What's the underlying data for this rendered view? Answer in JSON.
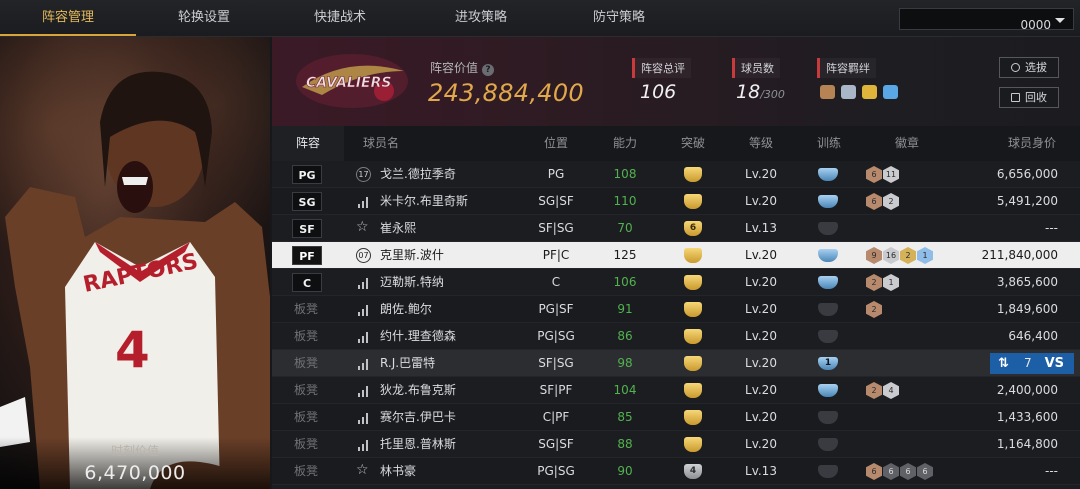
{
  "tabs": [
    "阵容管理",
    "轮换设置",
    "快捷战术",
    "进攻策略",
    "防守策略"
  ],
  "team_select": {
    "value": "0000"
  },
  "portrait": {
    "value_label": "时刻价值",
    "value": "6,470,000"
  },
  "header": {
    "team_logo_text": "CAVALIERS",
    "value_label": "阵容价值",
    "value": "243,884,400",
    "total_rating_label": "阵容总评",
    "total_rating": "106",
    "player_count_label": "球员数",
    "player_count": "18",
    "player_count_max": "/300",
    "bond_label": "阵容羁绊",
    "pick_button": "选拔",
    "recycle_button": "回收"
  },
  "columns": [
    "阵容",
    "球员名",
    "位置",
    "能力",
    "突破",
    "等级",
    "训练",
    "徽章",
    "球员身价"
  ],
  "rows": [
    {
      "lineup": "PG",
      "starter": true,
      "icon": "num",
      "icon_text": "17",
      "name": "戈兰.德拉季奇",
      "position": "PG",
      "ability": "108",
      "ability_color": "green",
      "break": "",
      "break_color": "gold",
      "level": "Lv.20",
      "train": "",
      "train_color": "blue",
      "badges": [
        {
          "t": "6",
          "c": "bz"
        },
        {
          "t": "11",
          "c": "sv"
        }
      ],
      "value": "6,656,000"
    },
    {
      "lineup": "SG",
      "starter": true,
      "icon": "bars",
      "icon_text": "",
      "name": "米卡尔.布里奇斯",
      "position": "SG|SF",
      "ability": "110",
      "ability_color": "green",
      "break": "",
      "break_color": "gold",
      "level": "Lv.20",
      "train": "",
      "train_color": "blue",
      "badges": [
        {
          "t": "6",
          "c": "bz"
        },
        {
          "t": "2",
          "c": "sv"
        }
      ],
      "value": "5,491,200"
    },
    {
      "lineup": "SF",
      "starter": true,
      "icon": "star",
      "icon_text": "",
      "name": "崔永熙",
      "position": "SF|SG",
      "ability": "70",
      "ability_color": "green",
      "break": "6",
      "break_color": "gold",
      "level": "Lv.13",
      "train": "",
      "train_color": "dark",
      "badges": [],
      "value": "---"
    },
    {
      "lineup": "PF",
      "starter": true,
      "icon": "num",
      "icon_text": "07",
      "name": "克里斯.波什",
      "position": "PF|C",
      "ability": "125",
      "ability_color": "plain",
      "break": "",
      "break_color": "gold",
      "level": "Lv.20",
      "train": "",
      "train_color": "blue",
      "badges": [
        {
          "t": "9",
          "c": "bz"
        },
        {
          "t": "16",
          "c": "sv"
        },
        {
          "t": "2",
          "c": "gd"
        },
        {
          "t": "1",
          "c": "bl"
        }
      ],
      "value": "211,840,000"
    },
    {
      "lineup": "C",
      "starter": true,
      "icon": "bars",
      "icon_text": "",
      "name": "迈勒斯.特纳",
      "position": "C",
      "ability": "106",
      "ability_color": "green",
      "break": "",
      "break_color": "gold",
      "level": "Lv.20",
      "train": "",
      "train_color": "blue",
      "badges": [
        {
          "t": "2",
          "c": "bz"
        },
        {
          "t": "1",
          "c": "sv"
        }
      ],
      "value": "3,865,600"
    },
    {
      "lineup": "板凳",
      "starter": false,
      "icon": "bars",
      "icon_text": "",
      "name": "朗佐.鲍尔",
      "position": "PG|SF",
      "ability": "91",
      "ability_color": "green",
      "break": "",
      "break_color": "gold",
      "level": "Lv.20",
      "train": "",
      "train_color": "dark",
      "badges": [
        {
          "t": "2",
          "c": "bz"
        }
      ],
      "value": "1,849,600"
    },
    {
      "lineup": "板凳",
      "starter": false,
      "icon": "bars",
      "icon_text": "",
      "name": "约什.理查德森",
      "position": "PG|SG",
      "ability": "86",
      "ability_color": "green",
      "break": "",
      "break_color": "gold",
      "level": "Lv.20",
      "train": "",
      "train_color": "dark",
      "badges": [],
      "value": "646,400"
    },
    {
      "lineup": "板凳",
      "starter": false,
      "icon": "bars",
      "icon_text": "",
      "name": "R.J.巴雷特",
      "position": "SF|SG",
      "ability": "98",
      "ability_color": "green",
      "break": "",
      "break_color": "gold",
      "level": "Lv.20",
      "train": "1",
      "train_color": "blue",
      "badges": [],
      "value": "",
      "vs": true,
      "vs_digit": "7",
      "vs_label": "VS"
    },
    {
      "lineup": "板凳",
      "starter": false,
      "icon": "bars",
      "icon_text": "",
      "name": "狄龙.布鲁克斯",
      "position": "SF|PF",
      "ability": "104",
      "ability_color": "green",
      "break": "",
      "break_color": "gold",
      "level": "Lv.20",
      "train": "",
      "train_color": "blue",
      "badges": [
        {
          "t": "2",
          "c": "bz"
        },
        {
          "t": "4",
          "c": "sv"
        }
      ],
      "value": "2,400,000"
    },
    {
      "lineup": "板凳",
      "starter": false,
      "icon": "bars",
      "icon_text": "",
      "name": "赛尔吉.伊巴卡",
      "position": "C|PF",
      "ability": "85",
      "ability_color": "green",
      "break": "",
      "break_color": "gold",
      "level": "Lv.20",
      "train": "",
      "train_color": "dark",
      "badges": [],
      "value": "1,433,600"
    },
    {
      "lineup": "板凳",
      "starter": false,
      "icon": "bars",
      "icon_text": "",
      "name": "托里恩.普林斯",
      "position": "SG|SF",
      "ability": "88",
      "ability_color": "green",
      "break": "",
      "break_color": "gold",
      "level": "Lv.20",
      "train": "",
      "train_color": "dark",
      "badges": [],
      "value": "1,164,800"
    },
    {
      "lineup": "板凳",
      "starter": false,
      "icon": "star",
      "icon_text": "",
      "name": "林书豪",
      "position": "PG|SG",
      "ability": "90",
      "ability_color": "green",
      "break": "4",
      "break_color": "gray",
      "level": "Lv.13",
      "train": "",
      "train_color": "dark",
      "badges": [
        {
          "t": "6",
          "c": "bz"
        },
        {
          "t": "6",
          "c": "dk"
        },
        {
          "t": "6",
          "c": "dk"
        },
        {
          "t": "6",
          "c": "dk"
        }
      ],
      "value": "---"
    }
  ]
}
